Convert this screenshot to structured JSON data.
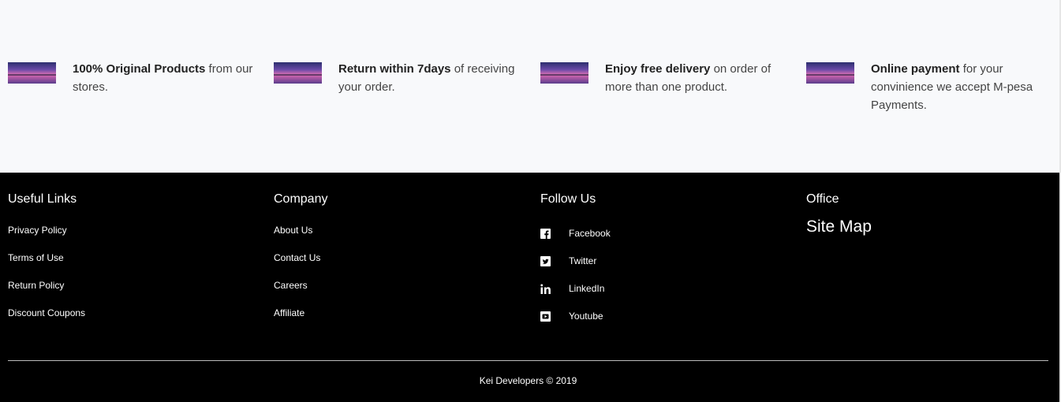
{
  "features": [
    {
      "bold": "100% Original Products",
      "rest": " from our stores."
    },
    {
      "bold": "Return within 7days",
      "rest": " of receiving your order."
    },
    {
      "bold": "Enjoy free delivery",
      "rest": " on order of more than one product."
    },
    {
      "bold": "Online payment",
      "rest": " for your convinience we accept M-pesa Payments."
    }
  ],
  "footer": {
    "useful_links": {
      "title": "Useful Links",
      "items": [
        "Privacy Policy",
        "Terms of Use",
        "Return Policy",
        "Discount Coupons"
      ]
    },
    "company": {
      "title": "Company",
      "items": [
        "About Us",
        "Contact Us",
        "Careers",
        "Affiliate"
      ]
    },
    "follow_us": {
      "title": "Follow Us",
      "items": [
        {
          "label": "Facebook",
          "icon": "facebook-icon"
        },
        {
          "label": "Twitter",
          "icon": "twitter-icon"
        },
        {
          "label": "LinkedIn",
          "icon": "linkedin-icon"
        },
        {
          "label": "Youtube",
          "icon": "youtube-icon"
        }
      ]
    },
    "office": {
      "title": "Office",
      "sitemap": "Site Map"
    },
    "copyright": "Kei Developers © 2019"
  },
  "colors": {
    "footer_bg": "#000000",
    "page_bg": "#f8f9fb"
  }
}
